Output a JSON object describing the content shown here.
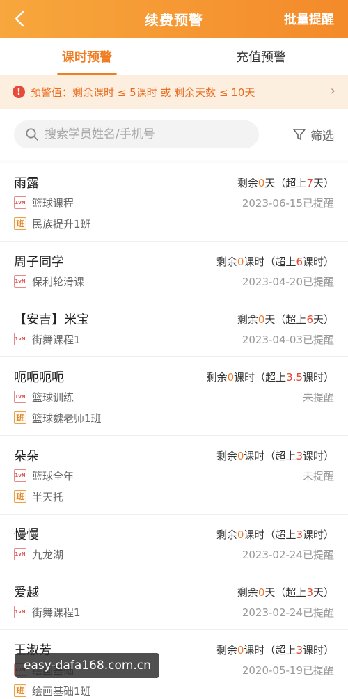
{
  "header": {
    "title": "续费预警",
    "batch_label": "批量提醒"
  },
  "tabs": [
    {
      "label": "课时预警",
      "active": true
    },
    {
      "label": "充值预警",
      "active": false
    }
  ],
  "notice": {
    "icon": "!",
    "text": "预警值：剩余课时 ≤ 5课时 或 剩余天数 ≤ 10天"
  },
  "search": {
    "placeholder": "搜索学员姓名/手机号",
    "filter_label": "筛选"
  },
  "students": [
    {
      "name": "雨露",
      "remain_pre": "剩余",
      "remain_num": "0",
      "remain_unit": "天（超上",
      "over_num": "7",
      "over_unit": "天）",
      "courses": [
        {
          "type": "1vN",
          "label": "篮球课程",
          "status": "2023-06-15已提醒"
        },
        {
          "type": "班",
          "label": "民族提升1班",
          "status": ""
        }
      ]
    },
    {
      "name": "周子同学",
      "remain_pre": "剩余",
      "remain_num": "0",
      "remain_unit": "课时（超上",
      "over_num": "6",
      "over_unit": "课时）",
      "courses": [
        {
          "type": "1vN",
          "label": "保利轮滑课",
          "status": "2023-04-20已提醒"
        }
      ]
    },
    {
      "name": "【安吉】米宝",
      "remain_pre": "剩余",
      "remain_num": "0",
      "remain_unit": "天（超上",
      "over_num": "6",
      "over_unit": "天）",
      "courses": [
        {
          "type": "1vN",
          "label": "街舞课程1",
          "status": "2023-04-03已提醒"
        }
      ]
    },
    {
      "name": "呃呃呃呃",
      "remain_pre": "剩余",
      "remain_num": "0",
      "remain_unit": "课时（超上",
      "over_num": "3.5",
      "over_unit": "课时）",
      "courses": [
        {
          "type": "1vN",
          "label": "篮球训练",
          "status": "未提醒"
        },
        {
          "type": "班",
          "label": "篮球魏老师1班",
          "status": ""
        }
      ]
    },
    {
      "name": "朵朵",
      "remain_pre": "剩余",
      "remain_num": "0",
      "remain_unit": "课时（超上",
      "over_num": "3",
      "over_unit": "课时）",
      "courses": [
        {
          "type": "1vN",
          "label": "篮球全年",
          "status": "未提醒"
        },
        {
          "type": "班",
          "label": "半天托",
          "status": ""
        }
      ]
    },
    {
      "name": "慢慢",
      "remain_pre": "剩余",
      "remain_num": "0",
      "remain_unit": "课时（超上",
      "over_num": "3",
      "over_unit": "课时）",
      "courses": [
        {
          "type": "1vN",
          "label": "九龙湖",
          "status": "2023-02-24已提醒"
        }
      ]
    },
    {
      "name": "爱越",
      "remain_pre": "剩余",
      "remain_num": "0",
      "remain_unit": "天（超上",
      "over_num": "3",
      "over_unit": "天）",
      "courses": [
        {
          "type": "1vN",
          "label": "街舞课程1",
          "status": "2023-02-24已提醒"
        }
      ]
    },
    {
      "name": "王淑芳",
      "remain_pre": "剩余",
      "remain_num": "0",
      "remain_unit": "课时（超上",
      "over_num": "3",
      "over_unit": "课时）",
      "courses": [
        {
          "type": "1vN",
          "label": "绘画基础",
          "status": "2020-05-19已提醒"
        },
        {
          "type": "班",
          "label": "绘画基础1班",
          "status": ""
        }
      ]
    }
  ],
  "watermark": "easy-dafa168.com.cn",
  "colors": {
    "accent": "#ef7d22",
    "header_start": "#f7a73d",
    "header_end": "#f48a2a",
    "warn_red": "#e64a3b"
  }
}
